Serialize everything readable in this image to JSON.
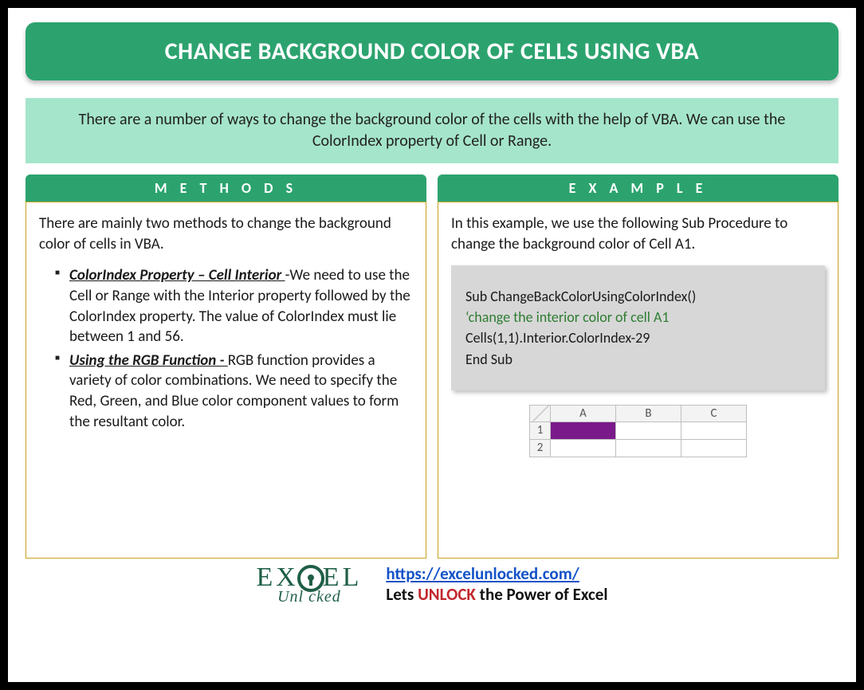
{
  "title": "CHANGE BACKGROUND COLOR OF CELLS USING VBA",
  "intro": "There are a number of ways to change the background color of the cells with the help of VBA. We can use the ColorIndex property of Cell or Range.",
  "columns": {
    "left": {
      "header": "M E T H O D S",
      "lead": "There are mainly two methods to change the background color of cells in VBA.",
      "items": [
        {
          "term": "ColorIndex Property – Cell Interior ",
          "dash": "-",
          "desc": "We need to use the Cell or Range with the Interior property followed by the ColorIndex property. The value of ColorIndex must lie between 1 and 56."
        },
        {
          "term": "Using the RGB Function - ",
          "dash": "",
          "desc": "RGB function provides a variety of color combinations. We need to specify the Red, Green, and Blue color component values to form the resultant color."
        }
      ]
    },
    "right": {
      "header": "E X A M P L E",
      "lead": "In this example, we use the following Sub Procedure to change the background color of Cell A1.",
      "code": {
        "l1": "Sub ChangeBackColorUsingColorIndex()",
        "l2": "‘change the interior color of cell A1",
        "l3": "Cells(1,1).Interior.ColorIndex-29",
        "l4": "End Sub"
      },
      "sheet": {
        "cols": [
          "A",
          "B",
          "C"
        ],
        "rows": [
          "1",
          "2"
        ],
        "filled_cell": "A1",
        "fill_color": "#7a1a8a"
      }
    }
  },
  "footer": {
    "logo_top_pre": "EX",
    "logo_top_post": "EL",
    "logo_bottom": "Unl  cked",
    "link": "https://excelunlocked.com/",
    "tag_pre": "Lets ",
    "tag_highlight": "UNLOCK",
    "tag_post": " the Power of Excel"
  }
}
